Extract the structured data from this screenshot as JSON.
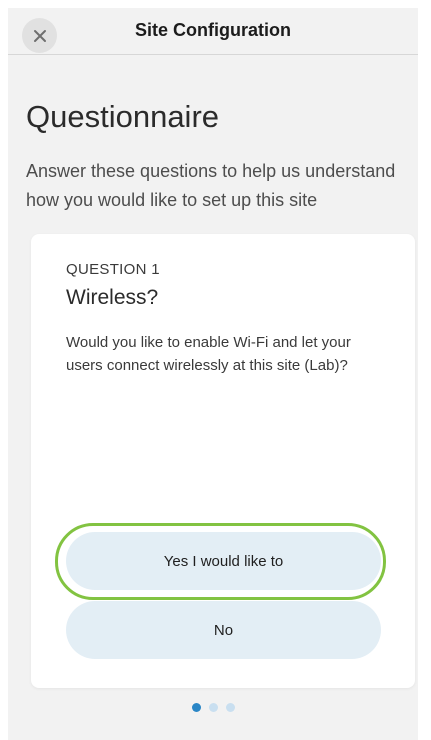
{
  "header": {
    "title": "Site Configuration",
    "close_icon": "close-icon"
  },
  "page": {
    "heading": "Questionnaire",
    "subtitle": "Answer these questions to help us understand how you would like to set up this site"
  },
  "question": {
    "number_label": "QUESTION 1",
    "title": "Wireless?",
    "description": "Would you like to enable Wi-Fi and let your users connect wirelessly at this site (Lab)?",
    "answers": [
      {
        "label": "Yes I would like to",
        "highlighted": true
      },
      {
        "label": "No",
        "highlighted": false
      }
    ]
  },
  "pager": {
    "total_pages": 3,
    "current_page": 1
  },
  "colors": {
    "background": "#f2f2f2",
    "card": "#ffffff",
    "button_fill": "#e3eef5",
    "highlight_ring": "#82c341",
    "pager_active": "#2a86c6",
    "pager_inactive": "#c9dff0"
  }
}
